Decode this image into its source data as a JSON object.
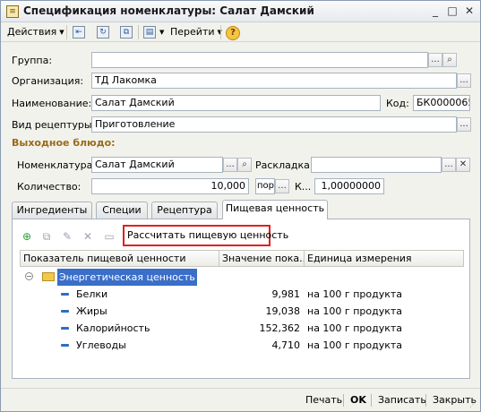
{
  "window": {
    "title": "Спецификация номенклатуры: Салат Дамский",
    "controls": {
      "minimize": "_",
      "maximize": "□",
      "close": "✕"
    }
  },
  "toolbar": {
    "actions_label": "Действия",
    "goto_label": "Перейти",
    "help_symbol": "?"
  },
  "form": {
    "group": {
      "label": "Группа:",
      "value": ""
    },
    "organization": {
      "label": "Организация:",
      "value": "ТД Лакомка"
    },
    "name": {
      "label": "Наименование:",
      "value": "Салат Дамский"
    },
    "code": {
      "label": "Код:",
      "value": "БК0000065"
    },
    "recipe_type": {
      "label": "Вид рецептуры:",
      "value": "Приготовление"
    },
    "output_section_title": "Выходное блюдо:",
    "nomenclature": {
      "label": "Номенклатура:",
      "value": "Салат Дамский"
    },
    "layout": {
      "label": "Раскладка:",
      "value": ""
    },
    "quantity": {
      "label": "Количество:",
      "value": "10,000",
      "unit": "порц",
      "k_label": "К...",
      "k_value": "1,00000000"
    },
    "buttons": {
      "select": "...",
      "search": "🔍",
      "clear": "✕"
    }
  },
  "tabs": [
    {
      "label": "Ингредиенты"
    },
    {
      "label": "Специи"
    },
    {
      "label": "Рецептура"
    },
    {
      "label": "Пищевая ценность"
    }
  ],
  "nutrition_panel": {
    "calculate_button_label": "Рассчитать пищевую ценность",
    "columns": [
      "Показатель пищевой ценности",
      "Значение пока...",
      "Единица измерения"
    ],
    "group_row": {
      "label": "Энергетическая ценность",
      "collapse_symbol": "−"
    },
    "rows": [
      {
        "name": "Белки",
        "value": "9,981",
        "unit": "на 100 г продукта"
      },
      {
        "name": "Жиры",
        "value": "19,038",
        "unit": "на 100 г продукта"
      },
      {
        "name": "Калорийность",
        "value": "152,362",
        "unit": "на 100 г продукта"
      },
      {
        "name": "Углеводы",
        "value": "4,710",
        "unit": "на 100 г продукта"
      }
    ]
  },
  "bottom": {
    "print": "Печать",
    "ok": "OK",
    "save": "Записать",
    "close": "Закрыть"
  }
}
